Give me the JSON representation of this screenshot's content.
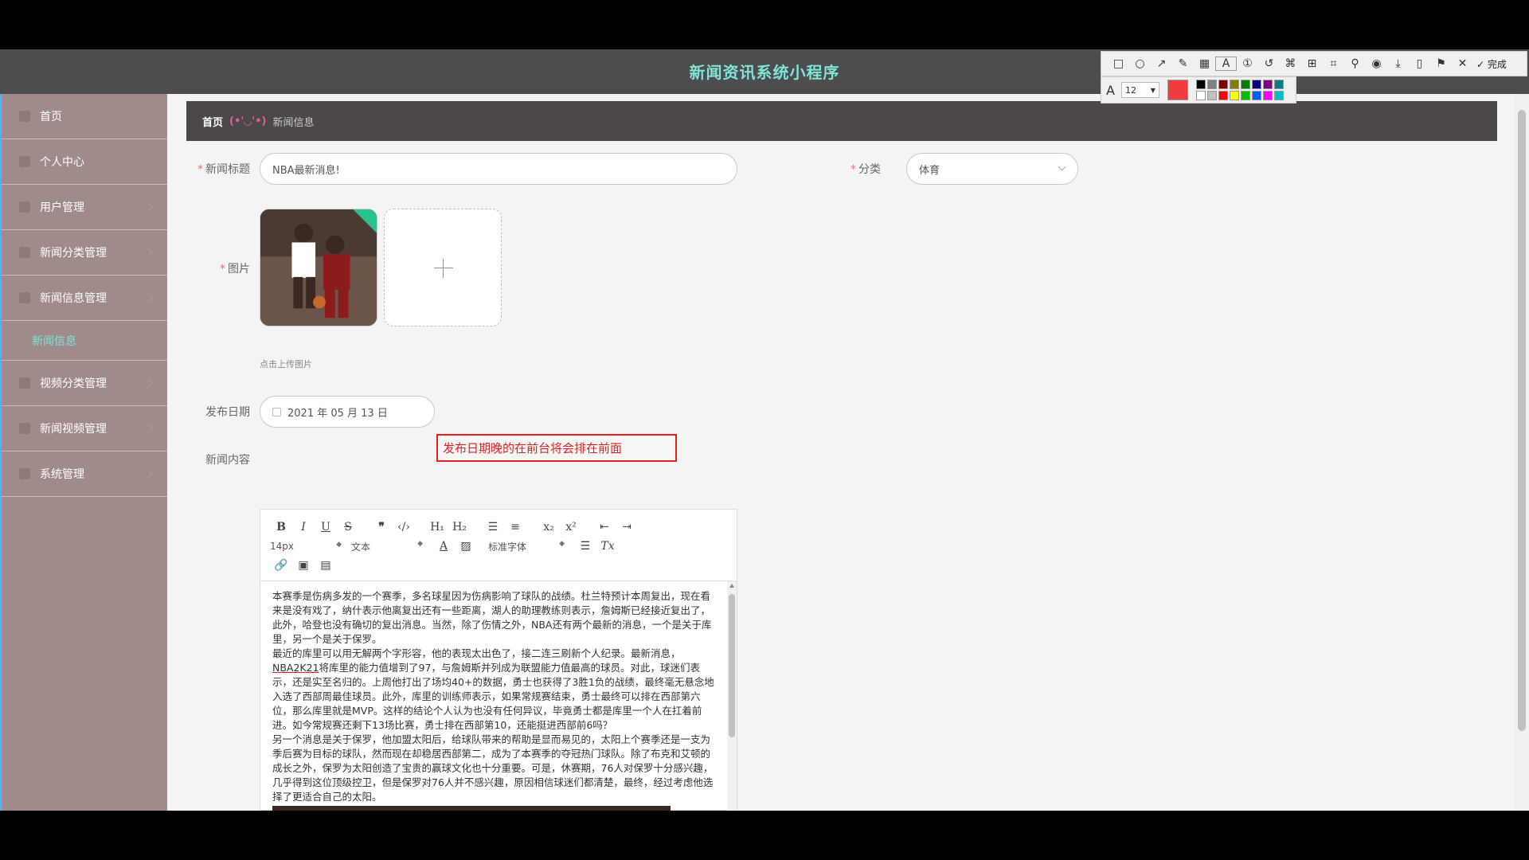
{
  "app": {
    "title": "新闻资讯系统小程序"
  },
  "sidebar": {
    "items": [
      {
        "label": "首页"
      },
      {
        "label": "个人中心"
      },
      {
        "label": "用户管理"
      },
      {
        "label": "新闻分类管理"
      },
      {
        "label": "新闻信息管理"
      }
    ],
    "active_sub": "新闻信息",
    "items_after": [
      {
        "label": "视频分类管理"
      },
      {
        "label": "新闻视频管理"
      },
      {
        "label": "系统管理"
      }
    ]
  },
  "breadcrumb": {
    "home": "首页",
    "separator": "(•'◡'•)",
    "current": "新闻信息"
  },
  "form": {
    "title_label": "新闻标题",
    "title_value": "NBA最新消息!",
    "category_label": "分类",
    "category_value": "体育",
    "image_label": "图片",
    "upload_tip": "点击上传图片",
    "date_label": "发布日期",
    "date_value": "2021 年 05 月 13 日",
    "content_label": "新闻内容"
  },
  "annotation": {
    "text": "发布日期晚的在前台将会排在前面"
  },
  "editor": {
    "font_size": "14px",
    "block_type": "文本",
    "font_family": "标准字体",
    "paragraphs": [
      "本赛季是伤病多发的一个赛季，多名球星因为伤病影响了球队的战绩。杜兰特预计本周复出，现在看来是没有戏了，纳什表示他离复出还有一些距离，湖人的助理教练则表示，詹姆斯已经接近复出了，此外，哈登也没有确切的复出消息。当然，除了伤情之外，NBA还有两个最新的消息，一个是关于库里，另一个是关于保罗。",
      "最近的库里可以用无解两个字形容，他的表现太出色了，接二连三刷新个人纪录。最新消息，",
      "NBA2K21",
      "将库里的能力值增到了97，与詹姆斯并列成为联盟能力值最高的球员。对此，球迷们表示，还是实至名归的。上周他打出了场均40+的数据，勇士也获得了3胜1负的战绩，最终毫无悬念地入选了西部周最佳球员。此外，库里的训练师表示，如果常规赛结束，勇士最终可以排在西部第六位，那么库里就是MVP。这样的结论个人认为也没有任何异议，毕竟勇士都是库里一个人在扛着前进。如今常规赛还剩下13场比赛，勇士排在西部第10，还能挺进西部前6吗？",
      "另一个消息是关于保罗，他加盟太阳后，给球队带来的帮助是显而易见的，太阳上个赛季还是一支为季后赛为目标的球队，然而现在却稳居西部第二，成为了本赛季的夺冠热门球队。除了布克和艾顿的成长之外，保罗为太阳创造了宝贵的赢球文化也十分重要。可是，休赛期，76人对保罗十分感兴趣，几乎得到这位顶级控卫，但是保罗对76人并不感兴趣，原因相信球迷们都清楚，最终，经过考虑他选择了更适合自己的太阳。"
    ]
  },
  "snip_tool": {
    "done_label": "完成",
    "font_size": "12",
    "current_color": "#f03c3c",
    "palette": [
      "#000000",
      "#808080",
      "#800000",
      "#808000",
      "#008000",
      "#000080",
      "#800080",
      "#008080",
      "#ffffff",
      "#c0c0c0",
      "#ff0000",
      "#ffff00",
      "#00c000",
      "#0060ff",
      "#ff00ff",
      "#00c0c0"
    ]
  },
  "colors": {
    "header_bg": "#4d4d4d",
    "title_color": "#7fe3d6",
    "sidebar_bg": "#a08a8a",
    "active_sub": "#7fe3d6"
  }
}
